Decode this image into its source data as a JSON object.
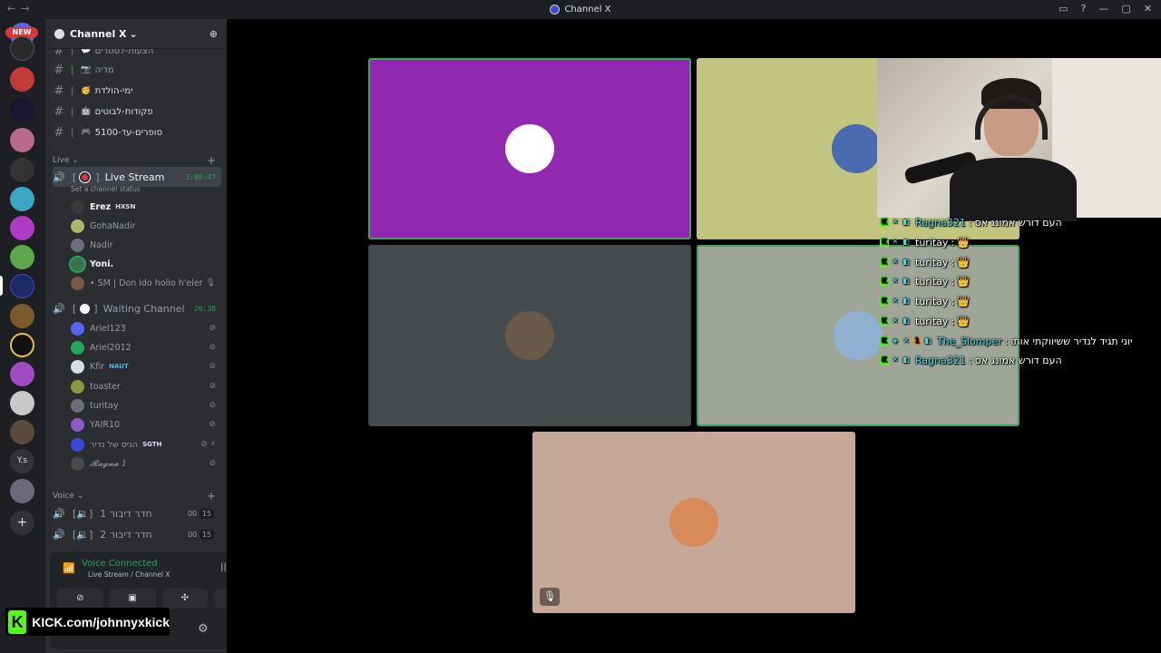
{
  "window": {
    "title": "Channel X"
  },
  "server_rail": {
    "new_badge": "NEW",
    "ys_label": "Y.s"
  },
  "guild": {
    "name": "Channel X"
  },
  "text_channels": [
    {
      "name": "הצעות-לסטרים",
      "emoji": "💬"
    },
    {
      "name": "מדיה",
      "emoji": "📷"
    },
    {
      "name": "ימי-הולדת",
      "emoji": "🥳"
    },
    {
      "name": "פקודות-לבוטים",
      "emoji": "🤖"
    },
    {
      "name": "סופרים-עד-5100",
      "emoji": "🎮"
    }
  ],
  "categories": {
    "live": "Live",
    "voice": "Voice"
  },
  "live_stream": {
    "name": "Live Stream",
    "timer": "3:08:47",
    "status_hint": "Set a channel status",
    "members": [
      {
        "name": "Erez",
        "tag": "HXSN",
        "color": "#f2f3f5",
        "avatar": "#3a3a3a"
      },
      {
        "name": "GohaNadir",
        "tag": "",
        "color": "#949ba4",
        "avatar": "#a9b86a"
      },
      {
        "name": "Nadir",
        "tag": "",
        "color": "#949ba4",
        "avatar": "#6d6f78"
      },
      {
        "name": "Yoni.",
        "tag": "",
        "color": "#f2f3f5",
        "avatar": "#3f6f4f"
      },
      {
        "name": "• SM | Don ido holio h'eler",
        "tag": "",
        "color": "#949ba4",
        "avatar": "#7a5a44"
      }
    ]
  },
  "waiting": {
    "name": "Waiting Channel",
    "timer": "26:38",
    "members": [
      {
        "name": "Ariel123",
        "tag": "",
        "avatar": "#5865f2"
      },
      {
        "name": "Ariel2012",
        "tag": "",
        "avatar": "#23a55a"
      },
      {
        "name": "Kfir",
        "tag": "NAUT",
        "avatar": "#dbdee1"
      },
      {
        "name": "toaster",
        "tag": "",
        "avatar": "#8a9a3a"
      },
      {
        "name": "turitay",
        "tag": "",
        "avatar": "#6d6f78"
      },
      {
        "name": "YAIR10",
        "tag": "",
        "avatar": "#8a5cc7"
      },
      {
        "name": "הגיס של נדיר",
        "tag": "SGTH",
        "avatar": "#3b4bd8"
      },
      {
        "name": "𝓡𝓪𝓰𝓷𝓪 1",
        "tag": "",
        "avatar": "#4a4a4a"
      }
    ]
  },
  "voice_channels": [
    {
      "name": "חדר דיבור 1",
      "count_a": "00",
      "count_b": "15"
    },
    {
      "name": "חדר דיבור 2",
      "count_a": "00",
      "count_b": "15"
    }
  ],
  "voice_panel": {
    "title": "Voice Connected",
    "subtitle": "Live Stream / Channel X"
  },
  "overlay": {
    "kick_url": "KICK.com/johnnyxkick"
  },
  "chat": [
    {
      "user": "Ragna321",
      "color": "#4fd8e8",
      "msg": "העם דורש אמונג אס"
    },
    {
      "user": "turitay",
      "color": "#ffffff",
      "msg": "👑"
    },
    {
      "user": "turitay",
      "color": "#ffffff",
      "msg": "👑"
    },
    {
      "user": "turitay",
      "color": "#ffffff",
      "msg": "👑"
    },
    {
      "user": "turitay",
      "color": "#ffffff",
      "msg": "👑"
    },
    {
      "user": "turitay",
      "color": "#ffffff",
      "msg": "👑"
    },
    {
      "user": "The_Slomper",
      "color": "#4fd8e8",
      "msg": "יוני תגיד לנדיר ששיווקתי אותו"
    },
    {
      "user": "Ragna321",
      "color": "#4fd8e8",
      "msg": "העם דורש אמונג אס"
    }
  ],
  "tiles": [
    {
      "name": "purple",
      "bg": "#9227b0",
      "avatar": "#ffffff"
    },
    {
      "name": "olive",
      "bg": "#c2c57f",
      "avatar": "#4a6bb0"
    },
    {
      "name": "dark",
      "bg": "#464b4d",
      "avatar": "#6a5a4a"
    },
    {
      "name": "sage",
      "bg": "#9fa698",
      "avatar": "#8fb0d0"
    },
    {
      "name": "tan",
      "bg": "#c5a898",
      "avatar": "#d88a5a"
    }
  ],
  "colors": {
    "accent_green": "#23a55a",
    "kick_green": "#53fc18",
    "speaking_border": "#3ba55c"
  }
}
